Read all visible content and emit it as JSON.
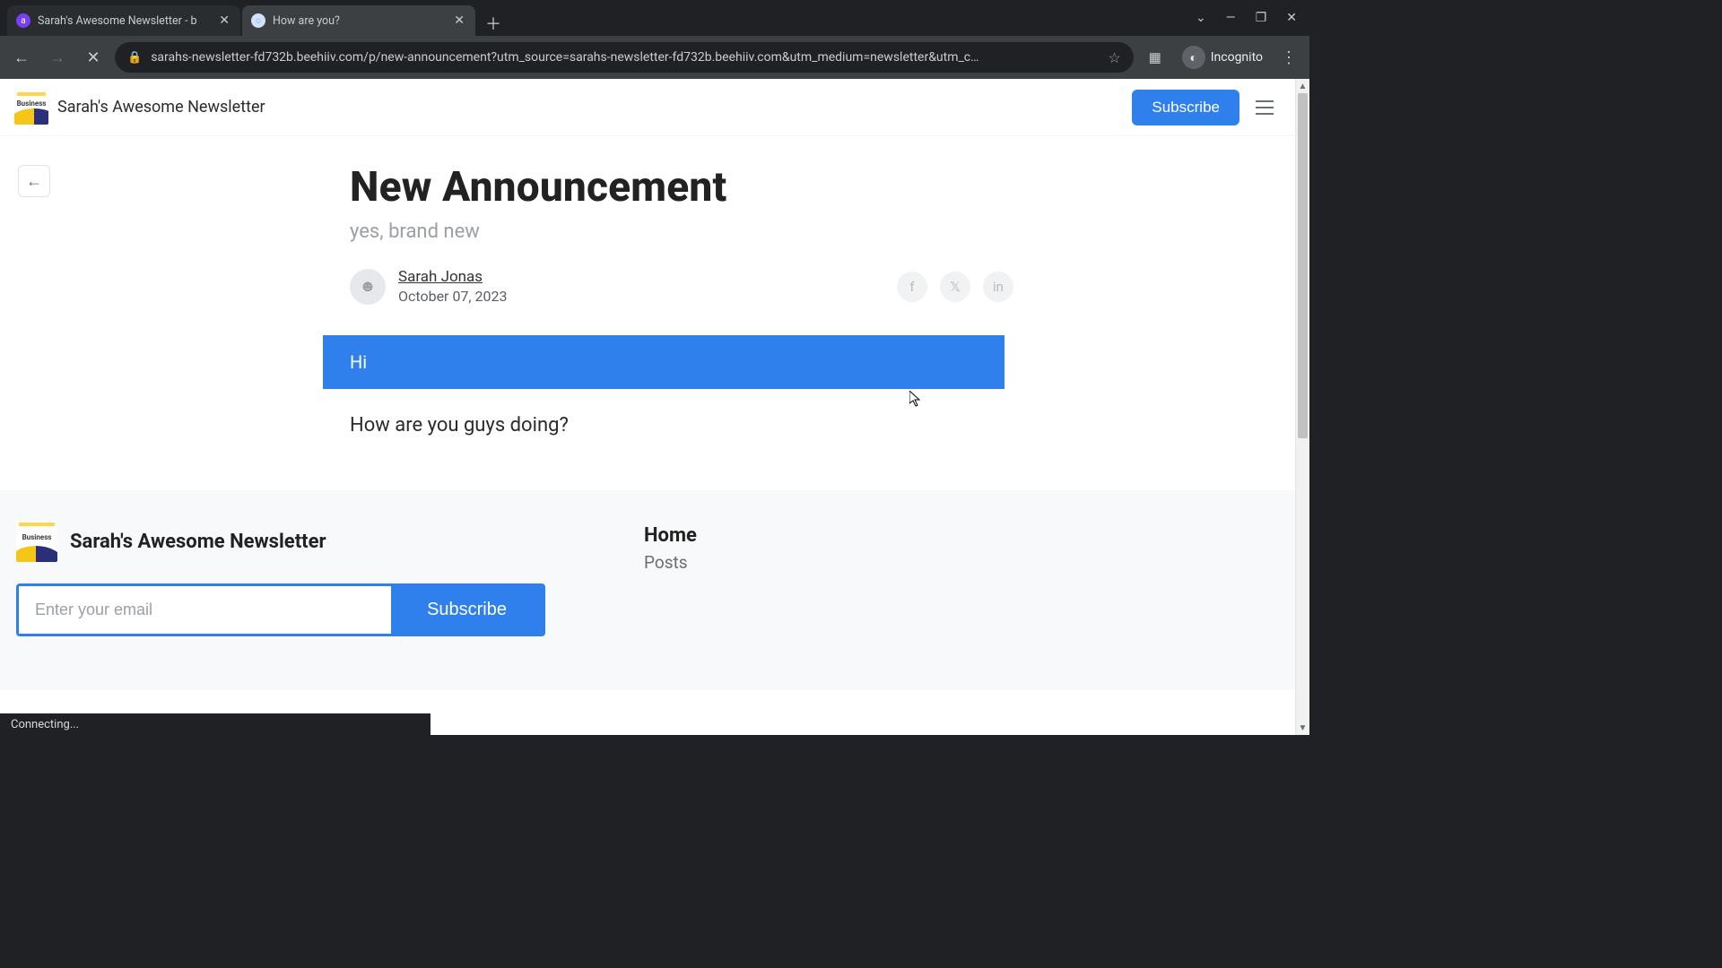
{
  "browser": {
    "tabs": [
      {
        "title": "Sarah's Awesome Newsletter - b",
        "active": false,
        "favicon_bg": "#7b3ff2",
        "favicon_glyph": "a"
      },
      {
        "title": "How are you?",
        "active": true,
        "favicon_bg": "#d0e2ff",
        "favicon_glyph": "◌"
      }
    ],
    "url": "sarahs-newsletter-fd732b.beehiiv.com/p/new-announcement?utm_source=sarahs-newsletter-fd732b.beehiiv.com&utm_medium=newsletter&utm_c…",
    "incognito_label": "Incognito",
    "status": "Connecting..."
  },
  "site": {
    "brand": "Sarah's Awesome Newsletter",
    "logo_text": "Business",
    "subscribe_label": "Subscribe"
  },
  "article": {
    "title": "New Announcement",
    "subtitle": "yes, brand new",
    "author": "Sarah Jonas",
    "date": "October 07, 2023",
    "hi": "Hi",
    "body_line": "How are you guys doing?"
  },
  "share_icons": {
    "facebook": "f",
    "x": "𝕏",
    "linkedin": "in"
  },
  "footer": {
    "brand": "Sarah's Awesome Newsletter",
    "email_placeholder": "Enter your email",
    "subscribe_label": "Subscribe",
    "nav_home": "Home",
    "nav_posts": "Posts"
  },
  "colors": {
    "accent": "#2f80ed"
  }
}
